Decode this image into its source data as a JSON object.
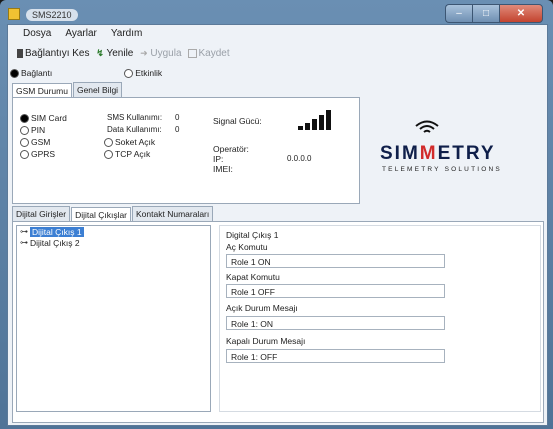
{
  "window": {
    "title": "SMS2210"
  },
  "menu": [
    "Dosya",
    "Ayarlar",
    "Yardım"
  ],
  "toolbar": {
    "disconnect": "Bağlantıyı Kes",
    "refresh": "Yenile",
    "apply": "Uygula",
    "save": "Kaydet"
  },
  "mode": {
    "connection": "Bağlantı",
    "activity": "Etkinlik"
  },
  "top_tabs": [
    "GSM Durumu",
    "Genel Bilgi"
  ],
  "gsm": {
    "sim_card": "SIM Card",
    "pin": "PIN",
    "gsm": "GSM",
    "gprs": "GPRS",
    "sms_usage_label": "SMS Kullanımı:",
    "sms_usage_value": "0",
    "data_usage_label": "Data Kullanımı:",
    "data_usage_value": "0",
    "socket_open": "Soket Açık",
    "tcp_open": "TCP Açık",
    "signal_label": "Signal Gücü:",
    "operator_label": "Operatör:",
    "ip_label": "IP:",
    "imei_label": "IMEI:",
    "ip_value": "0.0.0.0",
    "signal_level": 5
  },
  "logo": {
    "word_part1": "SIM",
    "word_part2": "ETRY",
    "subtitle": "TELEMETRY SOLUTIONS"
  },
  "bottom_tabs": [
    "Dijital Girişler",
    "Dijital Çıkışlar",
    "Kontakt Numaraları"
  ],
  "tree": [
    "Dijital Çıkış 1",
    "Dijital Çıkış 2"
  ],
  "detail": {
    "title": "Digital Çıkış 1",
    "on_cmd_label": "Aç Komutu",
    "on_cmd_value": "Role 1 ON",
    "off_cmd_label": "Kapat Komutu",
    "off_cmd_value": "Role 1 OFF",
    "on_msg_label": "Açık Durum Mesajı",
    "on_msg_value": "Role 1: ON",
    "off_msg_label": "Kapalı Durum Mesajı",
    "off_msg_value": "Role 1: OFF"
  },
  "colors": {
    "selection": "#3c7fd3",
    "logo_navy": "#0f1f4a",
    "logo_red": "#d12b2b"
  }
}
